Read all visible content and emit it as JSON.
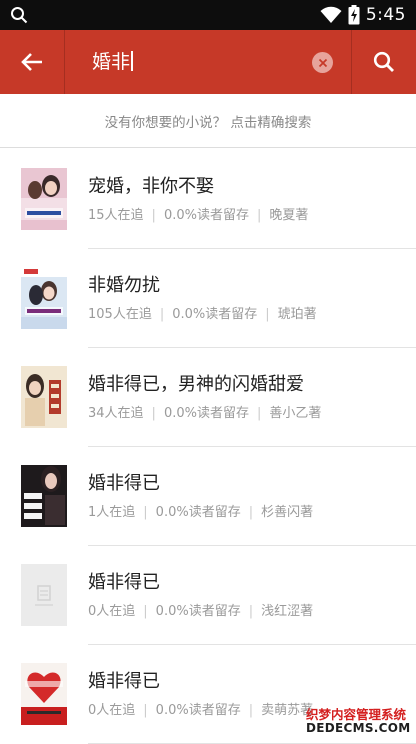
{
  "status_bar": {
    "time": "5:45",
    "icons": [
      "search-icon",
      "wifi-icon",
      "battery-charging-icon"
    ]
  },
  "toolbar": {
    "query": "婚非",
    "icons": [
      "back-arrow-icon",
      "clear-icon",
      "search-icon"
    ]
  },
  "hint": {
    "text": "没有你想要的小说？ 点击精确搜索"
  },
  "results": [
    {
      "title": "宠婚，非你不娶",
      "followers": "15人在追",
      "retention": "0.0%读者留存",
      "author": "晚夏著"
    },
    {
      "title": "非婚勿扰",
      "followers": "105人在追",
      "retention": "0.0%读者留存",
      "author": "琥珀著"
    },
    {
      "title": "婚非得已，男神的闪婚甜爱",
      "followers": "34人在追",
      "retention": "0.0%读者留存",
      "author": "善小乙著"
    },
    {
      "title": "婚非得已",
      "followers": "1人在追",
      "retention": "0.0%读者留存",
      "author": "杉善闪著"
    },
    {
      "title": "婚非得已",
      "followers": "0人在追",
      "retention": "0.0%读者留存",
      "author": "浅红涩著"
    },
    {
      "title": "婚非得已",
      "followers": "0人在追",
      "retention": "0.0%读者留存",
      "author": "卖萌苏著"
    }
  ],
  "watermark": {
    "line1": "织梦内容管理系统",
    "line2": "DEDECMS.COM"
  },
  "colors": {
    "toolbar": "#c63928",
    "status_bar": "#0d0d0d",
    "title_text": "#222222",
    "meta_text": "#9a9a9a"
  }
}
